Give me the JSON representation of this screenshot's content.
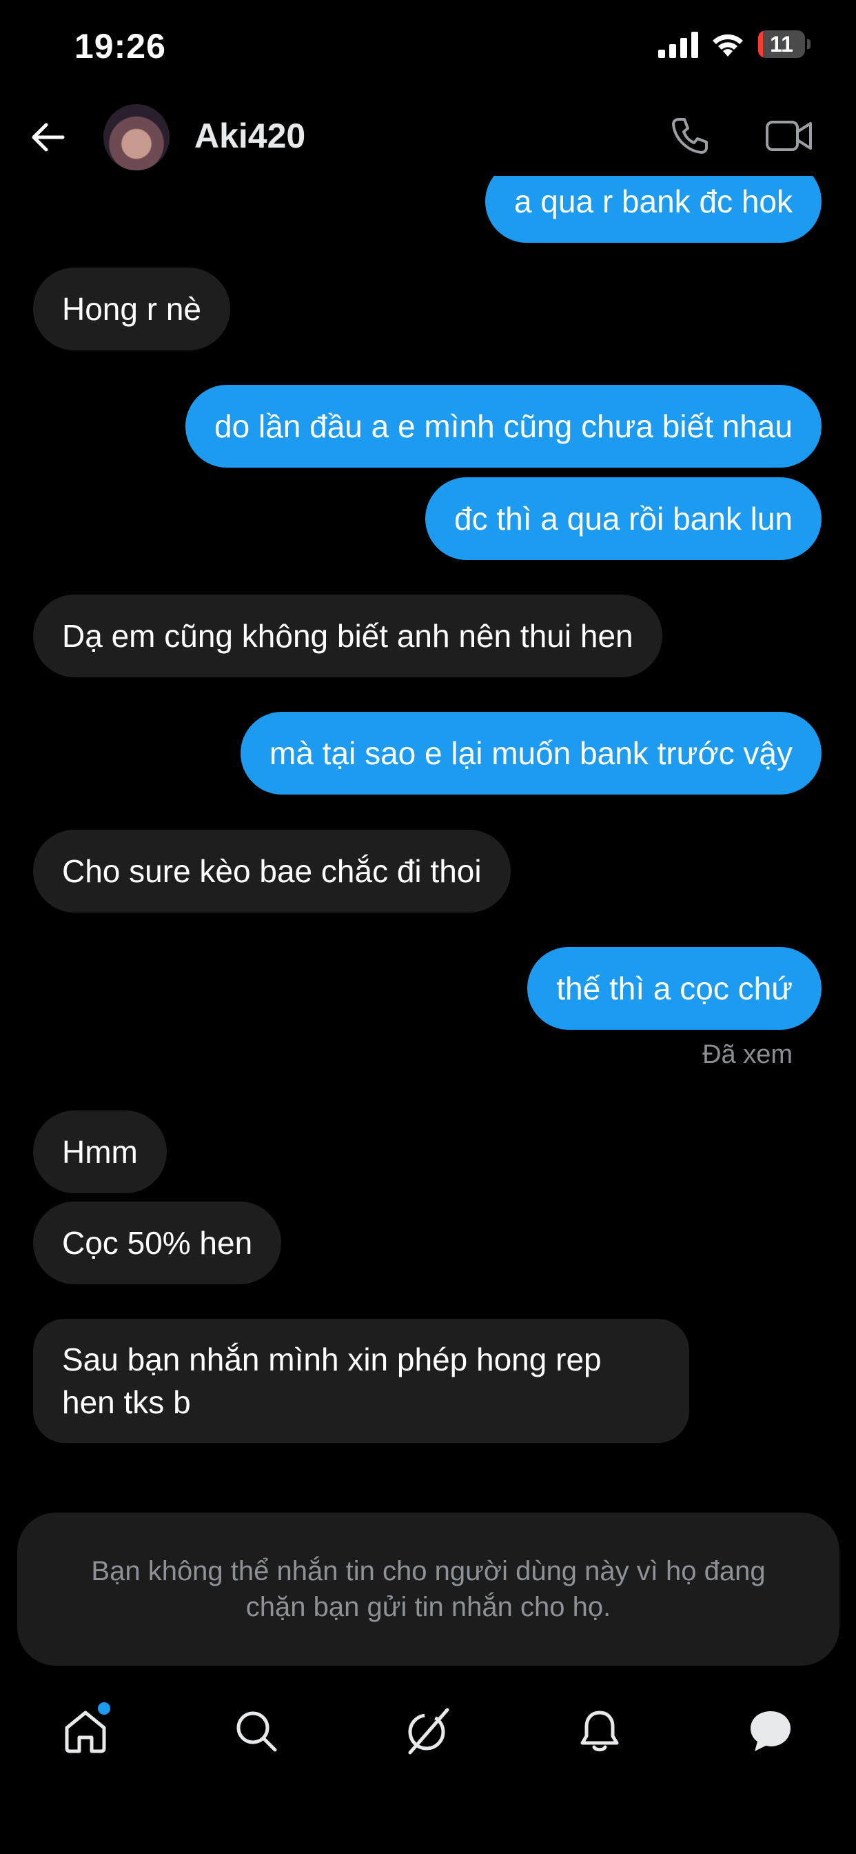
{
  "status_bar": {
    "time": "19:26",
    "battery": "11",
    "battery_level": 0.11
  },
  "header": {
    "username": "Aki420"
  },
  "messages": [
    {
      "side": "sent",
      "text": "a qua r bank đc hok"
    },
    {
      "side": "received",
      "text": "Hong r nè"
    },
    {
      "side": "sent",
      "text": "do lần đầu a e mình cũng chưa biết nhau"
    },
    {
      "side": "sent",
      "text": "đc thì a qua rồi bank lun"
    },
    {
      "side": "received",
      "text": "Dạ em cũng không biết anh nên thui hen"
    },
    {
      "side": "sent",
      "text": "mà tại sao e lại muốn bank trước vậy"
    },
    {
      "side": "received",
      "text": "Cho sure kèo bae chắc đi thoi"
    },
    {
      "side": "sent",
      "text": "thế thì a cọc chứ"
    },
    {
      "side": "received",
      "text": "Hmm"
    },
    {
      "side": "received",
      "text": "Cọc 50% hen"
    },
    {
      "side": "received",
      "text": "Sau bạn nhắn mình xin phép hong rep hen tks b"
    }
  ],
  "seen_label": "Đã xem",
  "blocked_notice": "Bạn không thể nhắn tin cho người dùng này vì họ đang chặn bạn gửi tin nhắn cho họ.",
  "nav": {
    "items": [
      "home-icon",
      "search-icon",
      "grok-icon",
      "notifications-icon",
      "messages-icon"
    ],
    "home_has_notification": true
  },
  "colors": {
    "accent": "#1d9bf0",
    "background": "#000000",
    "received_bubble": "#1e1e1e"
  }
}
